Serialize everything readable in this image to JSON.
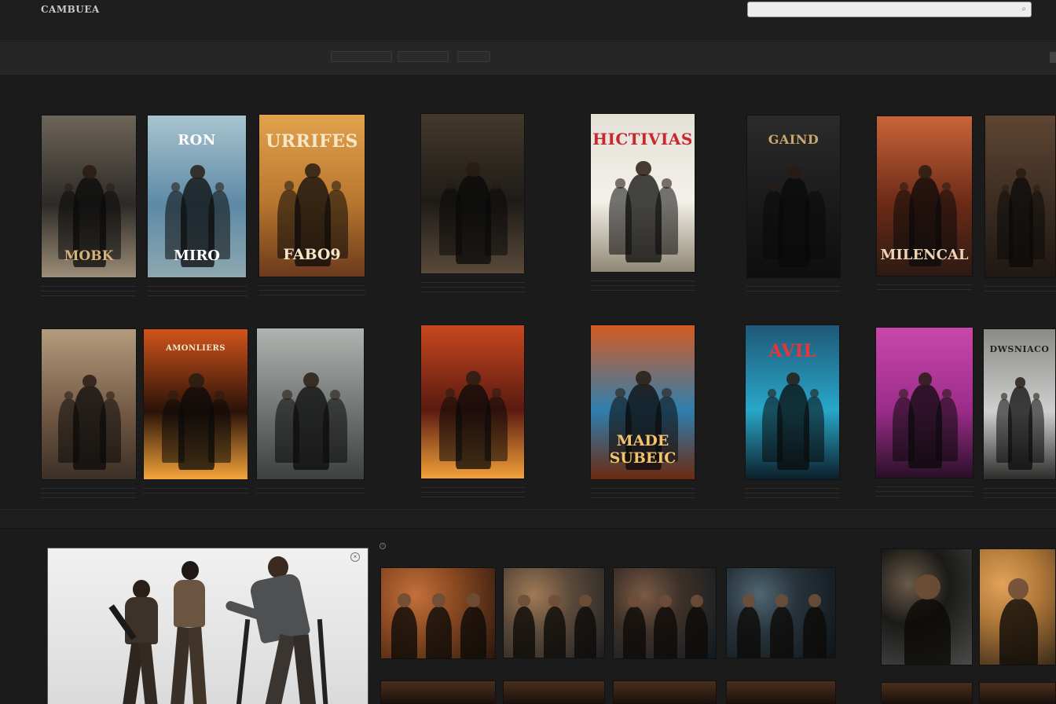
{
  "app": {
    "logo": "CAMBUEA"
  },
  "search": {
    "placeholder": "",
    "value": ""
  },
  "topnav": {
    "items": [
      "",
      "",
      ""
    ]
  },
  "subbar": {
    "title": "",
    "filters": [
      "",
      "",
      ""
    ],
    "right_label": ""
  },
  "catalog": {
    "section_label": "",
    "tabs": [
      "",
      "",
      "",
      "",
      ""
    ],
    "tab_right": "",
    "subcategory": "",
    "posters": [
      {
        "title": "",
        "bottom": "MOBK",
        "colors": [
          "#2d2a27",
          "#6d6458",
          "#9c8d77"
        ],
        "accent": "#d4b27a",
        "caption": [
          "",
          "",
          ""
        ]
      },
      {
        "title": "RON",
        "bottom": "MIRO",
        "colors": [
          "#5d8aa6",
          "#a9c4cf",
          "#8ea7b0"
        ],
        "accent": "#ffffff",
        "caption": [
          "",
          "",
          ""
        ]
      },
      {
        "title": "URRIFES",
        "bottom": "FABO9",
        "colors": [
          "#b7762e",
          "#e3a24d",
          "#6a3a1c"
        ],
        "accent": "#f5e7c7",
        "caption": [
          "",
          "",
          ""
        ]
      },
      {
        "title": "",
        "bottom": "",
        "colors": [
          "#1e1b17",
          "#44382c",
          "#5a4a3a"
        ],
        "accent": "#cccccc",
        "caption": [
          "",
          "",
          ""
        ]
      },
      {
        "title": "HICTIVIAS",
        "bottom": "",
        "colors": [
          "#f4f1ea",
          "#e3e0d7",
          "#8f8774"
        ],
        "accent": "#c8282d",
        "caption": [
          "",
          "",
          ""
        ]
      },
      {
        "title": "GAIND",
        "bottom": "",
        "colors": [
          "#1a1a1a",
          "#2b2b2b",
          "#0e0e0e"
        ],
        "accent": "#c9a86b",
        "caption": [
          "",
          ""
        ]
      },
      {
        "title": "",
        "bottom": "MILENCAL",
        "colors": [
          "#6b2a16",
          "#c9643a",
          "#2b1a14"
        ],
        "accent": "#efd3b6",
        "caption": [
          "",
          ""
        ]
      },
      {
        "title": "",
        "bottom": "",
        "colors": [
          "#3b2c21",
          "#5e4533",
          "#1f1712"
        ],
        "accent": "#e0c79a",
        "caption": [
          "",
          ""
        ]
      },
      {
        "title": "",
        "bottom": "",
        "colors": [
          "#735a45",
          "#b49b7d",
          "#3b2f25"
        ],
        "accent": "#efe2c2",
        "caption": [
          "",
          "",
          ""
        ]
      },
      {
        "title": "AMONLIERS",
        "bottom": "",
        "colors": [
          "#2a1208",
          "#d1541a",
          "#f5a43a"
        ],
        "accent": "#f3e6cc",
        "caption": [
          "",
          ""
        ]
      },
      {
        "title": "",
        "bottom": "",
        "colors": [
          "#6f7473",
          "#b0b4b0",
          "#3c403f"
        ],
        "accent": "#e4e4e4",
        "caption": [
          "",
          ""
        ]
      },
      {
        "title": "",
        "bottom": "",
        "colors": [
          "#5a1a10",
          "#c8481f",
          "#f3a13b"
        ],
        "accent": "#f6d28a",
        "caption": [
          "",
          "",
          ""
        ]
      },
      {
        "title": "",
        "bottom": "MADE SUBEIC",
        "colors": [
          "#2f7fae",
          "#d45a22",
          "#6b2a10"
        ],
        "accent": "#f3c46a",
        "caption": [
          "",
          "",
          ""
        ]
      },
      {
        "title": "AVIL",
        "bottom": "",
        "colors": [
          "#28a7c9",
          "#1f5878",
          "#0d1e2a"
        ],
        "accent": "#e8353a",
        "caption": [
          "",
          "",
          ""
        ]
      },
      {
        "title": "",
        "bottom": "",
        "colors": [
          "#9b2c8a",
          "#c947a9",
          "#2a1028"
        ],
        "accent": "#f4d2ee",
        "caption": [
          "",
          "",
          ""
        ]
      },
      {
        "title": "DWSNIACO",
        "bottom": "",
        "colors": [
          "#cfcfcf",
          "#8a8a86",
          "#2c2c2a"
        ],
        "accent": "#222222",
        "caption": [
          "",
          "",
          ""
        ]
      }
    ]
  },
  "featured": {
    "top_text": "",
    "title": "",
    "close": "×"
  },
  "bottom": {
    "label": "",
    "label2": "",
    "thumbs": [
      {
        "colors": [
          "#2a160d",
          "#8a4a22",
          "#c4703a"
        ]
      },
      {
        "colors": [
          "#1c1e22",
          "#5b4a3a",
          "#a07a55"
        ]
      },
      {
        "colors": [
          "#0f1a22",
          "#3c3028",
          "#7a5a44"
        ]
      },
      {
        "colors": [
          "#0d1418",
          "#27323a",
          "#4f6672"
        ]
      },
      {
        "colors": [
          "#4a4a48",
          "#1a1a18",
          "#6a5a48"
        ]
      },
      {
        "colors": [
          "#3a2a1a",
          "#b07838",
          "#e2a35a"
        ]
      }
    ],
    "thumb_captions": [
      "",
      "",
      "",
      ""
    ]
  }
}
